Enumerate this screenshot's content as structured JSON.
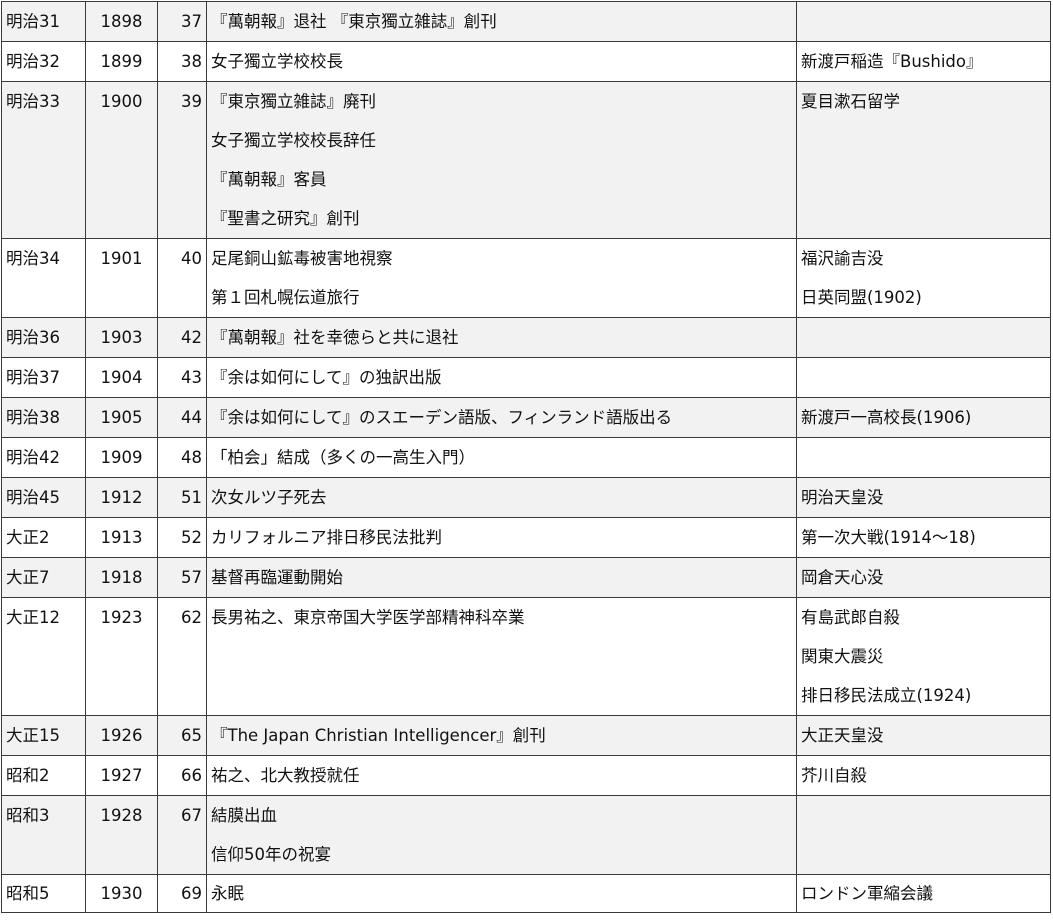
{
  "rows": [
    {
      "era": "明治31",
      "year": "1898",
      "age": "37",
      "events": [
        "『萬朝報』退社 『東京獨立雑誌』創刊"
      ],
      "world": []
    },
    {
      "era": "明治32",
      "year": "1899",
      "age": "38",
      "events": [
        "女子獨立学校校長"
      ],
      "world": [
        "新渡戸稲造『Bushido』"
      ]
    },
    {
      "era": "明治33",
      "year": "1900",
      "age": "39",
      "events": [
        "『東京獨立雑誌』廃刊",
        "女子獨立学校校長辞任",
        "『萬朝報』客員",
        "『聖書之研究』創刊"
      ],
      "world": [
        "夏目漱石留学"
      ]
    },
    {
      "era": "明治34",
      "year": "1901",
      "age": "40",
      "events": [
        "足尾銅山鉱毒被害地視察",
        "第１回札幌伝道旅行"
      ],
      "world": [
        "福沢諭吉没",
        "日英同盟(1902)"
      ]
    },
    {
      "era": "明治36",
      "year": "1903",
      "age": "42",
      "events": [
        "『萬朝報』社を幸徳らと共に退社"
      ],
      "world": []
    },
    {
      "era": "明治37",
      "year": "1904",
      "age": "43",
      "events": [
        "『余は如何にして』の独訳出版"
      ],
      "world": []
    },
    {
      "era": "明治38",
      "year": "1905",
      "age": "44",
      "events": [
        "『余は如何にして』のスエーデン語版、フィンランド語版出る"
      ],
      "world": [
        "新渡戸一高校長(1906)"
      ]
    },
    {
      "era": "明治42",
      "year": "1909",
      "age": "48",
      "events": [
        "「柏会」結成（多くの一高生入門）"
      ],
      "world": []
    },
    {
      "era": "明治45",
      "year": "1912",
      "age": "51",
      "events": [
        "次女ルツ子死去"
      ],
      "world": [
        "明治天皇没"
      ]
    },
    {
      "era": "大正2",
      "year": "1913",
      "age": "52",
      "events": [
        "カリフォルニア排日移民法批判"
      ],
      "world": [
        "第一次大戦(1914～18)"
      ]
    },
    {
      "era": "大正7",
      "year": "1918",
      "age": "57",
      "events": [
        "基督再臨運動開始"
      ],
      "world": [
        "岡倉天心没"
      ]
    },
    {
      "era": "大正12",
      "year": "1923",
      "age": "62",
      "events": [
        "長男祐之、東京帝国大学医学部精神科卒業"
      ],
      "world": [
        "有島武郎自殺",
        "関東大震災",
        "排日移民法成立(1924)"
      ]
    },
    {
      "era": "大正15",
      "year": "1926",
      "age": "65",
      "events": [
        "『The Japan Christian Intelligencer』創刊"
      ],
      "world": [
        "大正天皇没"
      ]
    },
    {
      "era": "昭和2",
      "year": "1927",
      "age": "66",
      "events": [
        "祐之、北大教授就任"
      ],
      "world": [
        "芥川自殺"
      ]
    },
    {
      "era": "昭和3",
      "year": "1928",
      "age": "67",
      "events": [
        "結膜出血",
        "信仰50年の祝宴"
      ],
      "world": []
    },
    {
      "era": "昭和5",
      "year": "1930",
      "age": "69",
      "events": [
        "永眠"
      ],
      "world": [
        "ロンドン軍縮会議"
      ]
    }
  ]
}
